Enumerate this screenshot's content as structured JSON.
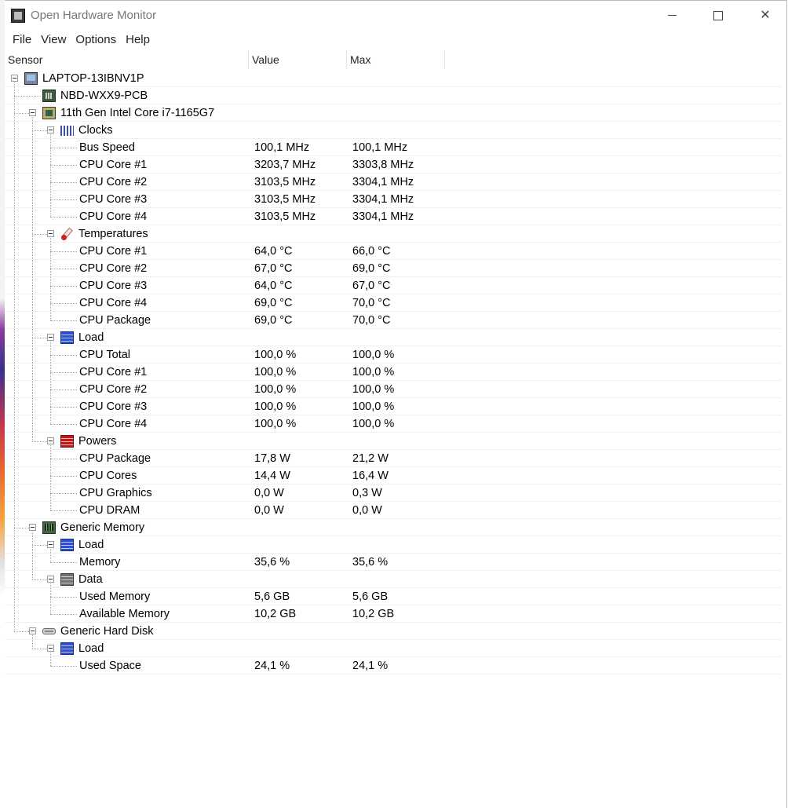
{
  "window": {
    "title": "Open Hardware Monitor",
    "icon": "app-chip-icon"
  },
  "menu": [
    "File",
    "View",
    "Options",
    "Help"
  ],
  "columns": {
    "sensor": "Sensor",
    "value": "Value",
    "max": "Max"
  },
  "rows": [
    {
      "level": 0,
      "icon": "laptop-icon",
      "label": "LAPTOP-13IBNV1P",
      "value": "",
      "max": "",
      "expandable": true
    },
    {
      "level": 1,
      "icon": "motherboard-icon",
      "label": "NBD-WXX9-PCB",
      "value": "",
      "max": "",
      "expandable": false
    },
    {
      "level": 1,
      "icon": "cpu-icon",
      "label": "11th Gen Intel Core i7-1165G7",
      "value": "",
      "max": "",
      "expandable": true
    },
    {
      "level": 2,
      "icon": "clock-icon",
      "label": "Clocks",
      "value": "",
      "max": "",
      "expandable": true
    },
    {
      "level": 3,
      "icon": "",
      "label": "Bus Speed",
      "value": "100,1 MHz",
      "max": "100,1 MHz",
      "expandable": false
    },
    {
      "level": 3,
      "icon": "",
      "label": "CPU Core #1",
      "value": "3203,7 MHz",
      "max": "3303,8 MHz",
      "expandable": false
    },
    {
      "level": 3,
      "icon": "",
      "label": "CPU Core #2",
      "value": "3103,5 MHz",
      "max": "3304,1 MHz",
      "expandable": false
    },
    {
      "level": 3,
      "icon": "",
      "label": "CPU Core #3",
      "value": "3103,5 MHz",
      "max": "3304,1 MHz",
      "expandable": false
    },
    {
      "level": 3,
      "icon": "",
      "label": "CPU Core #4",
      "value": "3103,5 MHz",
      "max": "3304,1 MHz",
      "expandable": false
    },
    {
      "level": 2,
      "icon": "thermometer-icon",
      "label": "Temperatures",
      "value": "",
      "max": "",
      "expandable": true
    },
    {
      "level": 3,
      "icon": "",
      "label": "CPU Core #1",
      "value": "64,0 °C",
      "max": "66,0 °C",
      "expandable": false
    },
    {
      "level": 3,
      "icon": "",
      "label": "CPU Core #2",
      "value": "67,0 °C",
      "max": "69,0 °C",
      "expandable": false
    },
    {
      "level": 3,
      "icon": "",
      "label": "CPU Core #3",
      "value": "64,0 °C",
      "max": "67,0 °C",
      "expandable": false
    },
    {
      "level": 3,
      "icon": "",
      "label": "CPU Core #4",
      "value": "69,0 °C",
      "max": "70,0 °C",
      "expandable": false
    },
    {
      "level": 3,
      "icon": "",
      "label": "CPU Package",
      "value": "69,0 °C",
      "max": "70,0 °C",
      "expandable": false
    },
    {
      "level": 2,
      "icon": "load-icon",
      "label": "Load",
      "value": "",
      "max": "",
      "expandable": true
    },
    {
      "level": 3,
      "icon": "",
      "label": "CPU Total",
      "value": "100,0 %",
      "max": "100,0 %",
      "expandable": false
    },
    {
      "level": 3,
      "icon": "",
      "label": "CPU Core #1",
      "value": "100,0 %",
      "max": "100,0 %",
      "expandable": false
    },
    {
      "level": 3,
      "icon": "",
      "label": "CPU Core #2",
      "value": "100,0 %",
      "max": "100,0 %",
      "expandable": false
    },
    {
      "level": 3,
      "icon": "",
      "label": "CPU Core #3",
      "value": "100,0 %",
      "max": "100,0 %",
      "expandable": false
    },
    {
      "level": 3,
      "icon": "",
      "label": "CPU Core #4",
      "value": "100,0 %",
      "max": "100,0 %",
      "expandable": false
    },
    {
      "level": 2,
      "icon": "power-icon",
      "label": "Powers",
      "value": "",
      "max": "",
      "expandable": true
    },
    {
      "level": 3,
      "icon": "",
      "label": "CPU Package",
      "value": "17,8 W",
      "max": "21,2 W",
      "expandable": false
    },
    {
      "level": 3,
      "icon": "",
      "label": "CPU Cores",
      "value": "14,4 W",
      "max": "16,4 W",
      "expandable": false
    },
    {
      "level": 3,
      "icon": "",
      "label": "CPU Graphics",
      "value": "0,0 W",
      "max": "0,3 W",
      "expandable": false
    },
    {
      "level": 3,
      "icon": "",
      "label": "CPU DRAM",
      "value": "0,0 W",
      "max": "0,0 W",
      "expandable": false
    },
    {
      "level": 1,
      "icon": "memory-icon",
      "label": "Generic Memory",
      "value": "",
      "max": "",
      "expandable": true
    },
    {
      "level": 2,
      "icon": "load-icon",
      "label": "Load",
      "value": "",
      "max": "",
      "expandable": true
    },
    {
      "level": 3,
      "icon": "",
      "label": "Memory",
      "value": "35,6 %",
      "max": "35,6 %",
      "expandable": false
    },
    {
      "level": 2,
      "icon": "data-icon",
      "label": "Data",
      "value": "",
      "max": "",
      "expandable": true
    },
    {
      "level": 3,
      "icon": "",
      "label": "Used Memory",
      "value": "5,6 GB",
      "max": "5,6 GB",
      "expandable": false
    },
    {
      "level": 3,
      "icon": "",
      "label": "Available Memory",
      "value": "10,2 GB",
      "max": "10,2 GB",
      "expandable": false
    },
    {
      "level": 1,
      "icon": "hard-disk-icon",
      "label": "Generic Hard Disk",
      "value": "",
      "max": "",
      "expandable": true
    },
    {
      "level": 2,
      "icon": "load-icon",
      "label": "Load",
      "value": "",
      "max": "",
      "expandable": true
    },
    {
      "level": 3,
      "icon": "",
      "label": "Used Space",
      "value": "24,1 %",
      "max": "24,1 %",
      "expandable": false
    }
  ]
}
